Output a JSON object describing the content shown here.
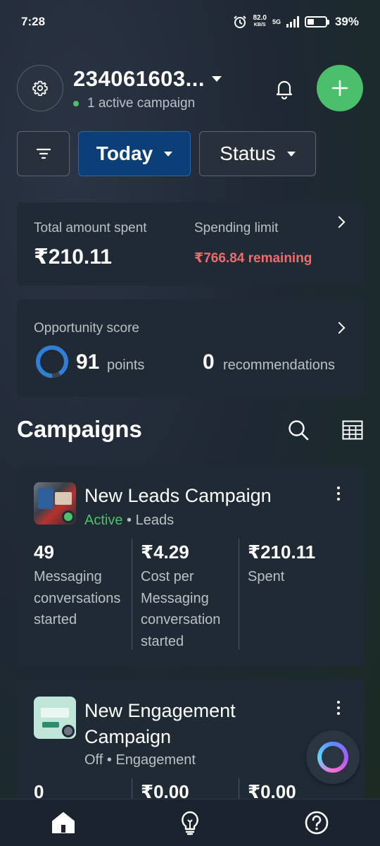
{
  "status_bar": {
    "time": "7:28",
    "net_speed": "82.0",
    "net_unit": "KB/S",
    "network": "5G",
    "battery": "39%"
  },
  "header": {
    "account_name": "234061603...",
    "active_status": "1 active campaign",
    "icons": {
      "settings": "gear-icon",
      "notifications": "bell-icon",
      "create": "plus-icon"
    }
  },
  "filters": {
    "date_label": "Today",
    "status_label": "Status"
  },
  "spend_card": {
    "total_label": "Total amount spent",
    "total_value": "₹210.11",
    "limit_label": "Spending limit",
    "remaining": "₹766.84 remaining"
  },
  "opportunity_card": {
    "label": "Opportunity score",
    "score": "91",
    "score_fraction": 0.91,
    "points_label": "points",
    "recommendations_count": "0",
    "recommendations_label": "recommendations"
  },
  "campaigns_section": {
    "title": "Campaigns"
  },
  "campaigns": [
    {
      "name": "New Leads Campaign",
      "status": "Active",
      "separator": "•",
      "objective": "Leads",
      "metrics": [
        {
          "value": "49",
          "label": "Messaging conversations started"
        },
        {
          "value": "₹4.29",
          "label": "Cost per Messaging conversation started"
        },
        {
          "value": "₹210.11",
          "label": "Spent"
        }
      ]
    },
    {
      "name": "New Engagement Campaign",
      "status": "Off",
      "separator": "•",
      "objective": "Engagement",
      "metrics": [
        {
          "value": "0"
        },
        {
          "value": "₹0.00"
        },
        {
          "value": "₹0.00"
        }
      ]
    }
  ],
  "colors": {
    "accent_green": "#4bbf6b",
    "today_blue": "#0c3f78",
    "remaining_red": "#f06a6e",
    "card_bg": "#1f2a35"
  },
  "bottom_nav": {
    "items": [
      "home-icon",
      "lightbulb-icon",
      "help-icon"
    ]
  }
}
